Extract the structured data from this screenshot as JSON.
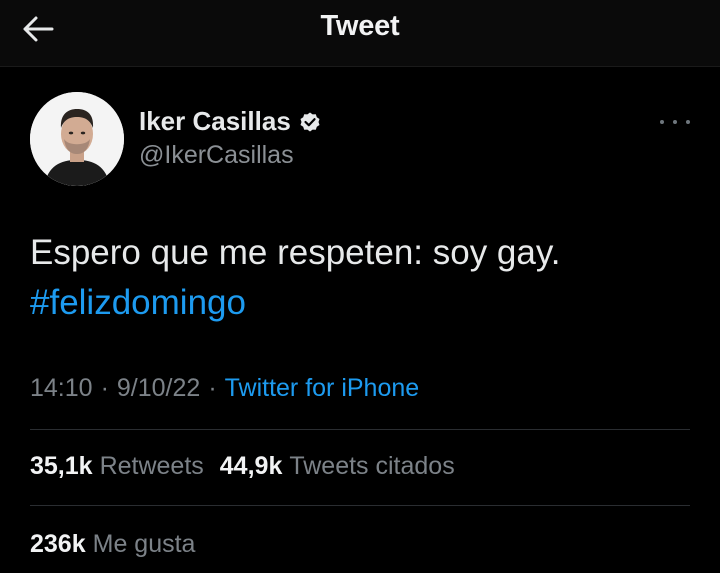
{
  "header": {
    "title": "Tweet",
    "back_icon": "arrow-left-icon"
  },
  "tweet": {
    "author": {
      "name": "Iker Casillas",
      "handle": "@IkerCasillas",
      "verified": true
    },
    "text_line1": "Espero que me respeten: soy gay.",
    "hashtag": "#felizdomingo",
    "time": "14:10",
    "date": "9/10/22",
    "separator": "·",
    "source": "Twitter for iPhone",
    "stats": {
      "retweets_count": "35,1k",
      "retweets_label": "Retweets",
      "quotes_count": "44,9k",
      "quotes_label": "Tweets citados",
      "likes_count": "236k",
      "likes_label": "Me gusta"
    }
  },
  "colors": {
    "background": "#000000",
    "accent": "#1d9bf0",
    "secondary_text": "#7c8288"
  }
}
